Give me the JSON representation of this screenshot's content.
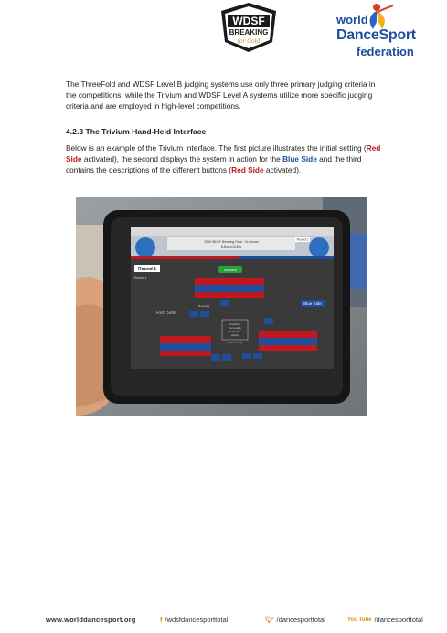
{
  "header": {
    "breaking_logo_line1": "WDSF",
    "breaking_logo_line2": "BREAKING",
    "breaking_logo_script": "for Gold",
    "wds_logo_line1": "world",
    "wds_logo_line2": "DanceSport",
    "wds_logo_line3": "federation"
  },
  "body": {
    "para1": "The ThreeFold and WDSF Level B judging systems use only three primary judging criteria in the competitions, while the Trivium and WDSF Level A systems utilize more specific judging criteria and are employed in high-level competitions.",
    "heading": "4.2.3 The Trivium Hand-Held Interface",
    "para2_a": "Below is an example of the Trivium Interface. The first picture illustrates the initial setting (",
    "para2_b": "Red Side",
    "para2_c": " activated), the second displays the system in action for the ",
    "para2_d": "Blue Side",
    "para2_e": " and the third contains the descriptions of the different buttons (",
    "para2_f": "Red Side",
    "para2_g": " activated)."
  },
  "tablet": {
    "round_label": "Round 1",
    "round_small": "Round 1",
    "submit_label": "submit",
    "red_side_label": "Red Side",
    "blue_side_label": "Blue Side",
    "center_labels": [
      "Creativity",
      "Personality",
      "Technique",
      "Variety",
      "Performativity",
      "Musicality"
    ],
    "top_center_line1": "2019 WDSF Breaking Final · Vs Round",
    "top_center_line2": "B-Boy vs B-Boy",
    "right_badge": "Round 1"
  },
  "footer": {
    "website": "www.worlddancesport.org",
    "facebook": "/wdsfdancesporttotal",
    "twitter": "/dancesporttotal",
    "youtube": "/dancesporttotal",
    "youtube_icon": "You Tube"
  },
  "colors": {
    "accent_red": "#c0181f",
    "accent_blue": "#1f4e9c",
    "footer_icon": "#e08a1a"
  }
}
